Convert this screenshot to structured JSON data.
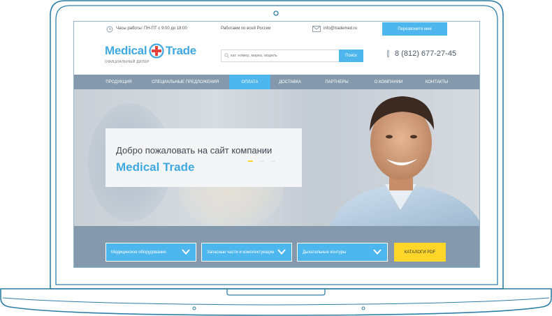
{
  "topbar": {
    "hours": "Часы работы: ПН-ПТ с 9:00 до 18:00",
    "region": "Работаем по всей России",
    "email": "info@trademed.ru",
    "callback_label": "Перезвоните мне"
  },
  "logo": {
    "word1": "Medical",
    "word2": "Trade",
    "subtitle": "ОФИЦИАЛЬНЫЙ ДИЛЕР"
  },
  "search": {
    "placeholder": "кат. номер, марка, модель",
    "button_label": "Поиск"
  },
  "phone": "8 (812) 677-27-45",
  "nav": {
    "items": [
      {
        "label": "ПРОДУКЦИЯ",
        "active": false
      },
      {
        "label": "СПЕЦИАЛЬНЫЕ ПРЕДЛОЖЕНИЯ",
        "active": false
      },
      {
        "label": "ОПЛАТА",
        "active": true
      },
      {
        "label": "ДОСТАВКА",
        "active": false
      },
      {
        "label": "ПАРТНЕРЫ",
        "active": false
      },
      {
        "label": "О КОМПАНИИ",
        "active": false
      },
      {
        "label": "КОНТАКТЫ",
        "active": false
      }
    ]
  },
  "hero": {
    "welcome_line1": "Добро пожаловать на сайт компании",
    "welcome_line2": "Medical Trade",
    "slide_count": 3,
    "active_slide": 1
  },
  "filters": [
    {
      "label": "Медицинское оборудование"
    },
    {
      "label": "Запасные части и комплектующие"
    },
    {
      "label": "Дыхательные контуры"
    }
  ],
  "catalog_button": "КАТАЛОГИ PDF",
  "colors": {
    "accent": "#4db6ec",
    "nav_bg": "#8499ab",
    "catalog_yellow": "#ffd629",
    "frame_stroke": "#2e7fa6"
  },
  "icons": {
    "clock": "clock-icon",
    "mail": "mail-icon",
    "search": "search-icon",
    "phone": "phone-icon",
    "chevron": "chevron-down-icon",
    "logo_cross": "medical-cross-icon"
  }
}
